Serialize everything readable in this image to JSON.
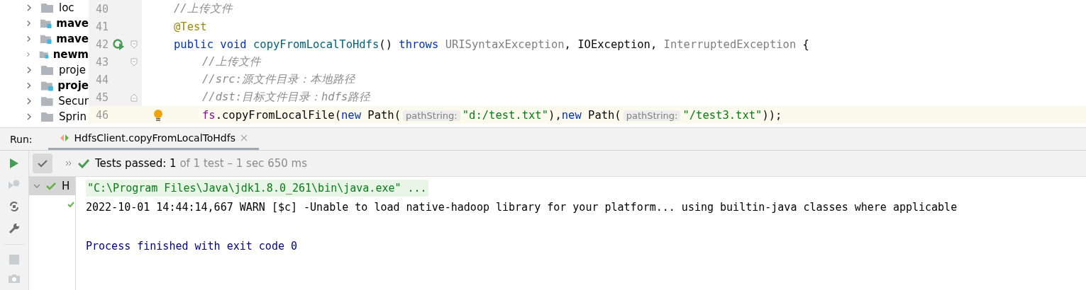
{
  "project_tree": [
    {
      "label": "loc",
      "kind": "folder",
      "bold": false
    },
    {
      "label": "mave",
      "kind": "module",
      "bold": true
    },
    {
      "label": "mave",
      "kind": "module",
      "bold": true
    },
    {
      "label": "newm",
      "kind": "module",
      "bold": true
    },
    {
      "label": "proje",
      "kind": "folder",
      "bold": false
    },
    {
      "label": "proje",
      "kind": "module",
      "bold": true
    },
    {
      "label": "Secur",
      "kind": "folder",
      "bold": false
    },
    {
      "label": "Sprin",
      "kind": "folder",
      "bold": false
    }
  ],
  "editor": {
    "lines": [
      {
        "number": "40",
        "current": false,
        "run_icon": false,
        "fold_start": false,
        "fold_end": false,
        "bulb": false,
        "tokens": [
          {
            "kind": "comment",
            "text": "//上传文件"
          }
        ]
      },
      {
        "number": "41",
        "current": false,
        "run_icon": false,
        "fold_start": false,
        "fold_end": false,
        "bulb": false,
        "tokens": [
          {
            "kind": "annotation",
            "text": "@Test"
          }
        ]
      },
      {
        "number": "42",
        "current": false,
        "run_icon": true,
        "fold_start": true,
        "fold_end": false,
        "bulb": false,
        "tokens": [
          {
            "kind": "keyword",
            "text": "public void "
          },
          {
            "kind": "method",
            "text": "copyFromLocalToHdfs"
          },
          {
            "kind": "plain",
            "text": "() "
          },
          {
            "kind": "keyword",
            "text": "throws "
          },
          {
            "kind": "unused",
            "text": "URISyntaxException"
          },
          {
            "kind": "plain",
            "text": ", IOException, "
          },
          {
            "kind": "unused",
            "text": "InterruptedException"
          },
          {
            "kind": "plain",
            "text": " {"
          }
        ],
        "children": [
          {
            "number": "43",
            "current": false,
            "run_icon": false,
            "fold_start": true,
            "fold_end": false,
            "bulb": false,
            "tokens": [
              {
                "kind": "comment",
                "text": "//上传文件"
              }
            ]
          },
          {
            "number": "44",
            "current": false,
            "run_icon": false,
            "fold_start": false,
            "fold_end": false,
            "bulb": false,
            "tokens": [
              {
                "kind": "comment",
                "text": "//src:源文件目录：本地路径"
              }
            ]
          },
          {
            "number": "45",
            "current": false,
            "run_icon": false,
            "fold_start": false,
            "fold_end": true,
            "bulb": false,
            "tokens": [
              {
                "kind": "comment",
                "text": "//dst:目标文件目录：hdfs路径"
              }
            ]
          },
          {
            "number": "46",
            "current": true,
            "run_icon": false,
            "fold_start": false,
            "fold_end": false,
            "bulb": true,
            "tokens": [
              {
                "kind": "field",
                "text": "fs"
              },
              {
                "kind": "plain",
                "text": ".copyFromLocalFile("
              },
              {
                "kind": "keyword",
                "text": "new "
              },
              {
                "kind": "plain",
                "text": "Path("
              },
              {
                "kind": "hint",
                "text": "pathString:"
              },
              {
                "kind": "string",
                "text": "\"d:/test.txt\""
              },
              {
                "kind": "plain",
                "text": "),"
              },
              {
                "kind": "keyword",
                "text": "new "
              },
              {
                "kind": "plain",
                "text": "Path("
              },
              {
                "kind": "hint",
                "text": "pathString:"
              },
              {
                "kind": "string",
                "text": "\"/test3.txt\""
              },
              {
                "kind": "plain",
                "text": "));"
              }
            ]
          }
        ]
      }
    ]
  },
  "run_panel": {
    "label": "Run:",
    "tabs": [
      {
        "label": "HdfsClient.copyFromLocalToHdfs",
        "selected": true
      }
    ],
    "status": {
      "passed": "Tests passed: 1",
      "detail": "of 1 test – 1 sec 650 ms"
    },
    "test_tree": [
      {
        "label": "H",
        "expanded": true,
        "passed": true,
        "children": [
          {
            "passed": true
          }
        ]
      }
    ],
    "console": [
      {
        "kind": "command",
        "text": "\"C:\\Program Files\\Java\\jdk1.8.0_261\\bin\\java.exe\" ..."
      },
      {
        "kind": "plain",
        "text": "2022-10-01 14:44:14,667 WARN [$c] -Unable to load native-hadoop library for your platform... using builtin-java classes where applicable"
      },
      {
        "kind": "blank"
      },
      {
        "kind": "exit",
        "text": "Process finished with exit code 0"
      }
    ]
  }
}
